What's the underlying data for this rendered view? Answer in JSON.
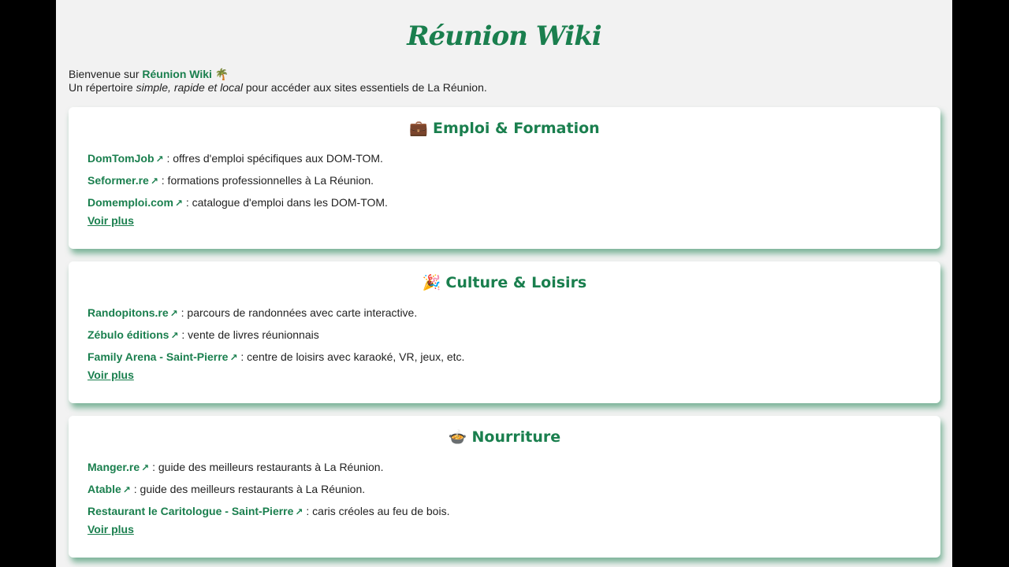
{
  "site": {
    "title": "Réunion Wiki",
    "welcome_prefix": "Bienvenue sur",
    "welcome_brand": "Réunion Wiki",
    "welcome_emoji": "🌴",
    "tagline_prefix": "Un répertoire ",
    "tagline_emphasis": "simple, rapide et local",
    "tagline_suffix": " pour accéder aux sites essentiels de La Réunion."
  },
  "colors": {
    "accent": "#1a7f4e",
    "page_bg": "#f2f2f2",
    "frame_bg": "#000000"
  },
  "sections": [
    {
      "emoji": "💼",
      "title": "Emploi & Formation",
      "more_label": "Voir plus",
      "links": [
        {
          "name": "DomTomJob",
          "location": "",
          "desc": ": offres d'emploi spécifiques aux DOM-TOM."
        },
        {
          "name": "Seformer.re",
          "location": "",
          "desc": ": formations professionnelles à La Réunion."
        },
        {
          "name": "Domemploi.com",
          "location": "",
          "desc": ": catalogue d'emploi dans les DOM-TOM."
        }
      ]
    },
    {
      "emoji": "🎉",
      "title": "Culture & Loisirs",
      "more_label": "Voir plus",
      "links": [
        {
          "name": "Randopitons.re",
          "location": "",
          "desc": ": parcours de randonnées avec carte interactive."
        },
        {
          "name": "Zébulo éditions",
          "location": "",
          "desc": ": vente de livres réunionnais"
        },
        {
          "name": "Family Arena",
          "location": "Saint-Pierre",
          "desc": ": centre de loisirs avec karaoké, VR, jeux, etc."
        }
      ]
    },
    {
      "emoji": "🍲",
      "title": "Nourriture",
      "more_label": "Voir plus",
      "links": [
        {
          "name": "Manger.re",
          "location": "",
          "desc": ": guide des meilleurs restaurants à La Réunion."
        },
        {
          "name": "Atable",
          "location": "",
          "desc": ": guide des meilleurs restaurants à La Réunion."
        },
        {
          "name": "Restaurant le Caritologue",
          "location": "Saint-Pierre",
          "desc": ": caris créoles au feu de bois."
        }
      ]
    }
  ],
  "icons": {
    "external_link": "external-link-icon",
    "external_glyph": "↗"
  }
}
